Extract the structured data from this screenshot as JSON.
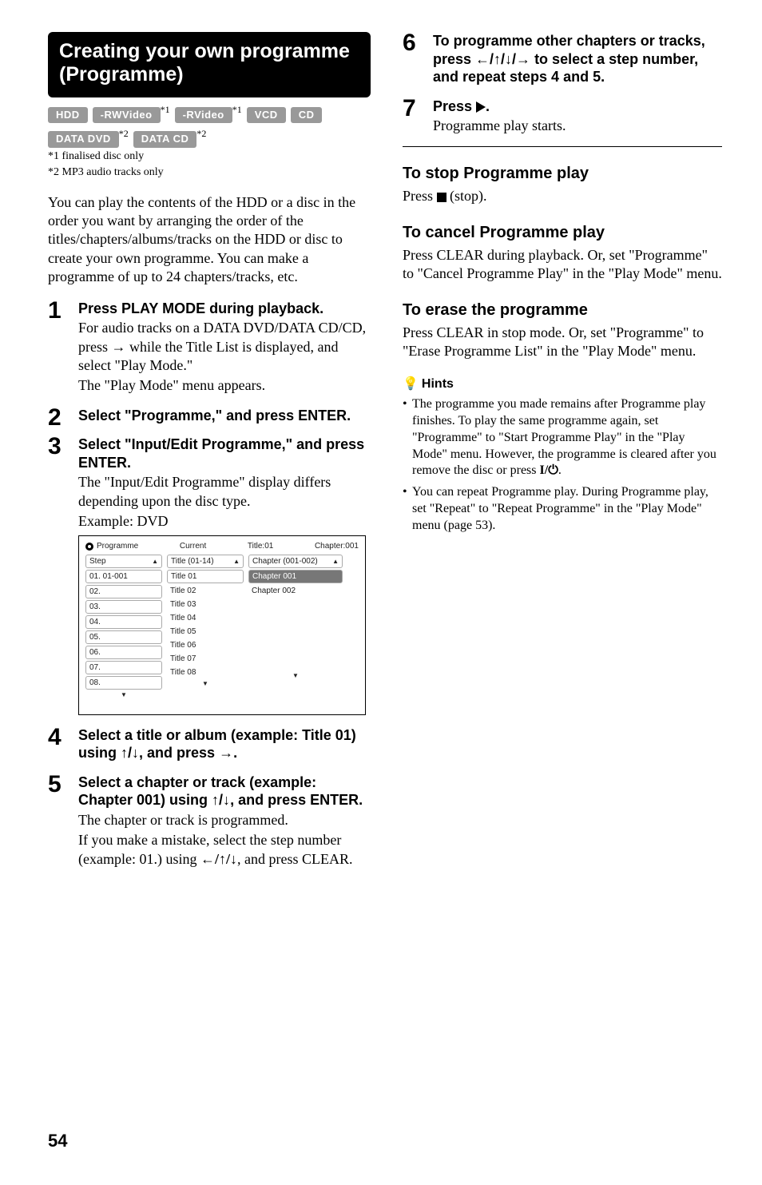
{
  "section": {
    "title": "Creating your own programme (Programme)"
  },
  "badges": {
    "b1": "HDD",
    "b2": "-RWVideo",
    "b3": "-RVideo",
    "b4": "VCD",
    "b5": "CD",
    "b6": "DATA DVD",
    "b7": "DATA CD",
    "s1": "*1",
    "s2": "*2"
  },
  "footnotes": {
    "f1": "*1 finalised disc only",
    "f2": "*2 MP3 audio tracks only"
  },
  "intro": "You can play the contents of the HDD or a disc in the order you want by arranging the order of the titles/chapters/albums/tracks on the HDD or disc to create your own programme. You can make a programme of up to 24 chapters/tracks, etc.",
  "steps": {
    "s1h": "Press PLAY MODE during playback.",
    "s1b1": "For audio tracks on a DATA DVD/DATA CD/CD, press ",
    "s1b2": " while the Title List is displayed, and select \"Play Mode.\"",
    "s1b3": "The \"Play Mode\" menu appears.",
    "s2h": "Select \"Programme,\" and press ENTER.",
    "s3h": "Select \"Input/Edit Programme,\" and press ENTER.",
    "s3b1": "The \"Input/Edit Programme\" display differs depending upon the disc type.",
    "s3b2": "Example: DVD",
    "s4h_a": "Select a title or album (example: Title 01) using ",
    "s4h_b": ", and press ",
    "s4h_c": ".",
    "s5h_a": "Select a chapter or track (example: Chapter 001) using ",
    "s5h_b": ", and press ENTER.",
    "s5b1": "The chapter or track is programmed.",
    "s5b2a": "If you make a mistake, select the step number (example: 01.) using ",
    "s5b2b": ", and press CLEAR.",
    "s6h_a": "To programme other chapters or tracks, press ",
    "s6h_b": " to select a step number, and repeat steps 4 and 5.",
    "s7h_a": "Press ",
    "s7h_b": ".",
    "s7b": "Programme play starts."
  },
  "arrows": {
    "right": "→",
    "updown": "↑/↓",
    "leftupdown": "←/↑/↓",
    "all": "←/↑/↓/→"
  },
  "stop": {
    "h": "To stop Programme play",
    "b_a": "Press ",
    "b_b": " (stop)."
  },
  "cancel": {
    "h": "To cancel Programme play",
    "b": "Press CLEAR during playback. Or, set \"Programme\" to \"Cancel Programme Play\" in the \"Play Mode\" menu."
  },
  "erase": {
    "h": "To erase the programme",
    "b": "Press CLEAR in stop mode. Or, set \"Programme\" to \"Erase Programme List\" in the \"Play Mode\" menu."
  },
  "hints": {
    "label": "Hints",
    "h1a": "The programme you made remains after Programme play finishes. To play the same programme again, set \"Programme\" to \"Start Programme Play\" in the \"Play Mode\" menu. However, the programme is cleared after you remove the disc or press ",
    "h1b": ".",
    "h2": "You can repeat Programme play. During Programme play, set \"Repeat\" to \"Repeat Programme\" in the \"Play Mode\" menu (page 53)."
  },
  "power_icon": "I/⏻",
  "prog": {
    "label": "Programme",
    "current": "Current",
    "title_no": "Title:01",
    "chapter_no": "Chapter:001",
    "col1h": "Step",
    "col2h": "Title (01-14)",
    "col3h": "Chapter (001-002)",
    "col1": [
      "01. 01-001",
      "02.",
      "03.",
      "04.",
      "05.",
      "06.",
      "07.",
      "08."
    ],
    "col2": [
      "Title 01",
      "Title 02",
      "Title 03",
      "Title 04",
      "Title 05",
      "Title 06",
      "Title 07",
      "Title 08"
    ],
    "col3": [
      "Chapter 001",
      "Chapter 002"
    ]
  },
  "page": "54"
}
